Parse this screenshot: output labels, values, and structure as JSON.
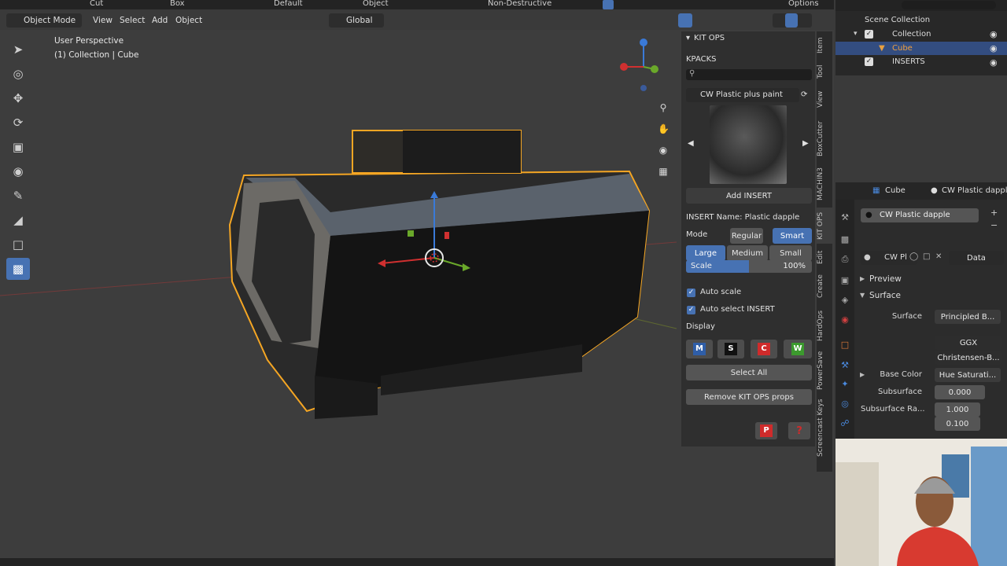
{
  "topbar": {
    "cut": "Cut",
    "box": "Box",
    "default": "Default",
    "object": "Object",
    "nondestructive": "Non-Destructive",
    "options": "Options"
  },
  "header": {
    "mode": "Object Mode",
    "menu": [
      "View",
      "Select",
      "Add",
      "Object"
    ],
    "orientation": "Global"
  },
  "viewport": {
    "perspective": "User Perspective",
    "collection": "(1) Collection | Cube"
  },
  "kitops": {
    "title": "KIT OPS",
    "kpacks": "KPACKS",
    "kpack_selected": "CW Plastic plus paint",
    "add_insert": "Add INSERT",
    "insert_name": "INSERT Name: Plastic dapple",
    "mode_label": "Mode",
    "mode_regular": "Regular",
    "mode_smart": "Smart",
    "size_large": "Large",
    "size_medium": "Medium",
    "size_small": "Small",
    "scale_label": "Scale",
    "scale_value": "100%",
    "scale_fraction": 1.0,
    "auto_scale": "Auto scale",
    "auto_select": "Auto select INSERT",
    "display": "Display",
    "disp_m": "M",
    "disp_s": "S",
    "disp_c": "C",
    "disp_w": "W",
    "select_all": "Select All",
    "remove_props": "Remove KIT OPS props",
    "p_btn": "P",
    "help_btn": "?"
  },
  "side_tabs": [
    "Item",
    "Tool",
    "View",
    "BoxCutter",
    "MACHIN3",
    "KIT OPS",
    "Edit",
    "Create",
    "HardOps",
    "PowerSave",
    "Screencast Keys"
  ],
  "outliner": {
    "root": "Scene Collection",
    "items": [
      {
        "name": "Collection"
      },
      {
        "name": "Cube"
      },
      {
        "name": "INSERTS"
      }
    ]
  },
  "properties": {
    "object": "Cube",
    "material_header": "CW Plastic dapple",
    "slot": "CW Plastic dapple",
    "mat_short": "CW Pl",
    "data": "Data",
    "preview": "Preview",
    "surface_panel": "Surface",
    "surface_label": "Surface",
    "surface_value": "Principled B...",
    "ggx": "GGX",
    "christensen": "Christensen-B...",
    "basecolor_label": "Base Color",
    "basecolor_value": "Hue Saturati...",
    "subsurface_label": "Subsurface",
    "subsurface_value": "0.000",
    "subsurface_ra_label": "Subsurface Ra...",
    "sr1": "1.000",
    "sr2": "0.100"
  },
  "colors": {
    "accent": "#4772b3",
    "selection": "#f5a623",
    "kit_red": "#d02b2b",
    "kit_green": "#3c9a2e"
  }
}
